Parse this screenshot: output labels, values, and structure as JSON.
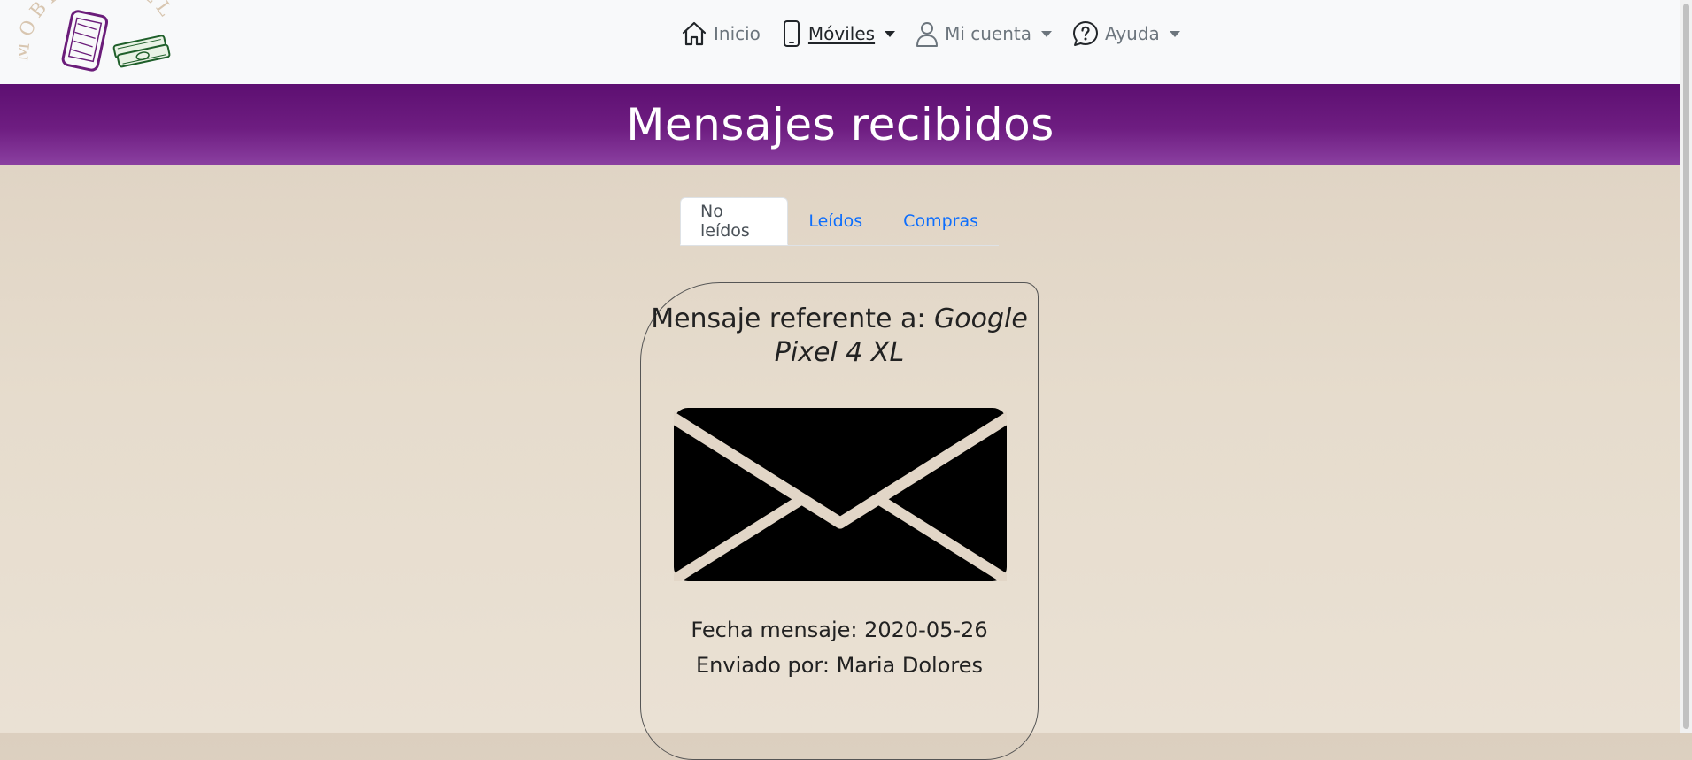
{
  "navbar": {
    "logo_text": "MOBILE SELL",
    "items": [
      {
        "label": "Inicio",
        "icon": "house-icon",
        "dropdown": false,
        "active": false
      },
      {
        "label": "Móviles",
        "icon": "phone-icon",
        "dropdown": true,
        "active": true
      },
      {
        "label": "Mi cuenta",
        "icon": "person-icon",
        "dropdown": true,
        "active": false
      },
      {
        "label": "Ayuda",
        "icon": "question-bubble-icon",
        "dropdown": true,
        "active": false
      }
    ]
  },
  "header": {
    "title": "Mensajes recibidos"
  },
  "tabs": [
    {
      "label": "No leídos",
      "active": true
    },
    {
      "label": "Leídos",
      "active": false
    },
    {
      "label": "Compras",
      "active": false
    }
  ],
  "message": {
    "title_prefix": "Mensaje referente a:",
    "product": "Google Pixel 4 XL",
    "icon": "envelope-icon",
    "date_label": "Fecha mensaje: 2020-05-26",
    "sender_label": "Enviado por: Maria Dolores"
  },
  "colors": {
    "header_purple": "#6a1a7e",
    "tab_link": "#0d6efd",
    "background_beige": "#e2d7c8"
  }
}
